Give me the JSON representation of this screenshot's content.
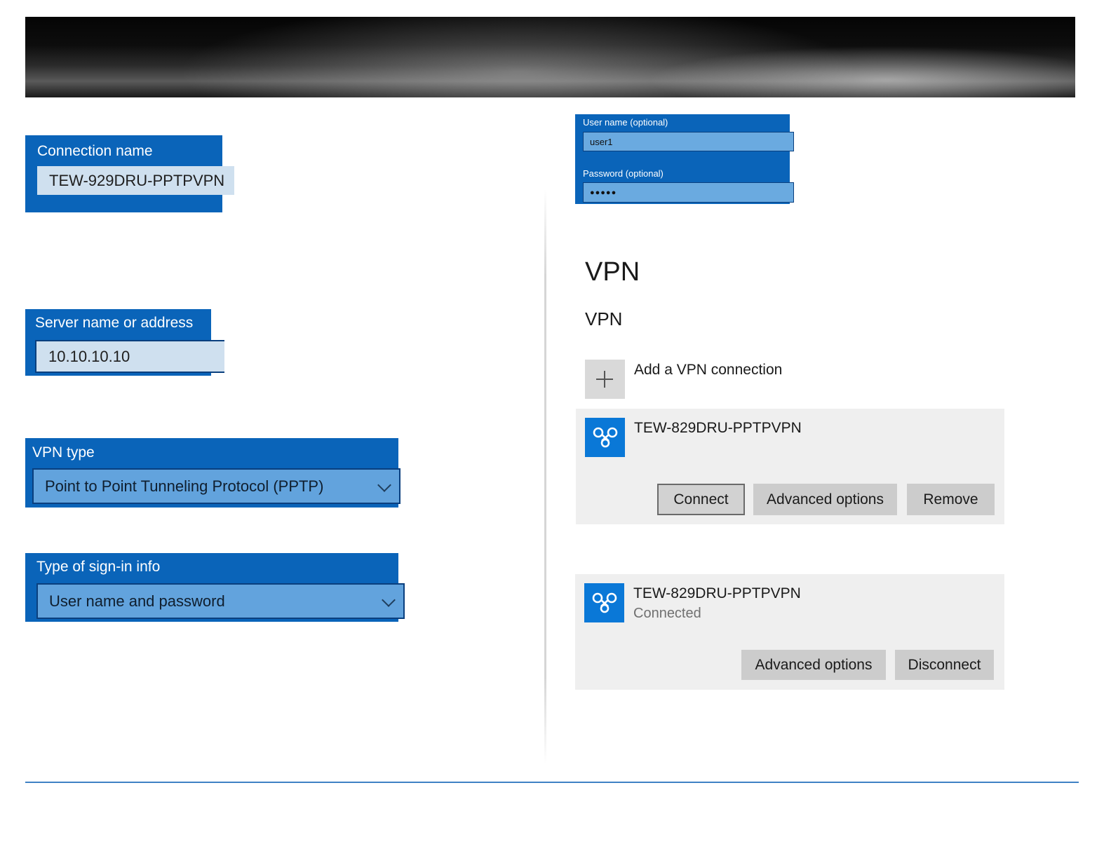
{
  "connection_name": {
    "label": "Connection name",
    "value": "TEW-929DRU-PPTPVPN"
  },
  "server": {
    "label": "Server name or address",
    "value": "10.10.10.10"
  },
  "vpn_type": {
    "label": "VPN type",
    "value": "Point to Point Tunneling Protocol (PPTP)"
  },
  "signin_type": {
    "label": "Type of sign-in info",
    "value": "User name and password"
  },
  "credentials": {
    "username_label": "User name (optional)",
    "username_value": "user1",
    "password_label": "Password (optional)",
    "password_value": "●●●●●"
  },
  "settings": {
    "page_title": "VPN",
    "section_title": "VPN",
    "add_label": "Add a VPN connection"
  },
  "card1": {
    "name": "TEW-829DRU-PPTPVPN",
    "connect": "Connect",
    "advanced": "Advanced options",
    "remove": "Remove"
  },
  "card2": {
    "name": "TEW-829DRU-PPTPVPN",
    "status": "Connected",
    "advanced": "Advanced options",
    "disconnect": "Disconnect"
  },
  "icons": {
    "vpn": "vpn-link-icon",
    "add": "plus-icon",
    "dropdown": "chevron-down-icon"
  },
  "colors": {
    "panel_blue": "#0a64b9",
    "tile_blue": "#0a78d7",
    "footer_line": "#3f82c4"
  }
}
